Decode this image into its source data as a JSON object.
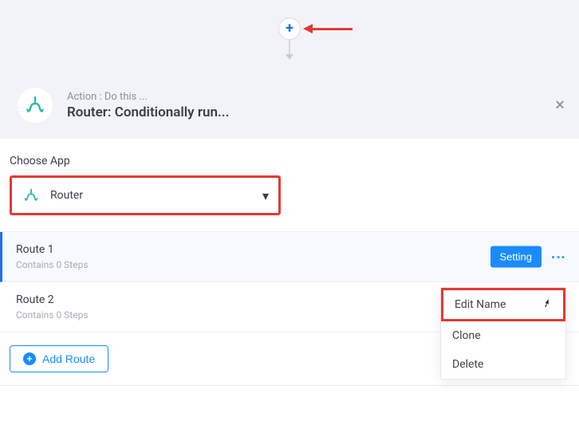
{
  "header": {
    "subtitle": "Action : Do this ...",
    "title": "Router: Conditionally run..."
  },
  "choose_app": {
    "label": "Choose App",
    "selected": "Router"
  },
  "routes": [
    {
      "name": "Route 1",
      "subtitle": "Contains 0 Steps",
      "setting_label": "Setting",
      "active": true
    },
    {
      "name": "Route 2",
      "subtitle": "Contains 0 Steps",
      "active": false
    }
  ],
  "context_menu": {
    "items": [
      {
        "label": "Edit Name",
        "highlight": true
      },
      {
        "label": "Clone",
        "highlight": false
      },
      {
        "label": "Delete",
        "highlight": false
      }
    ]
  },
  "add_route": {
    "label": "Add Route"
  },
  "colors": {
    "accent": "#1a8cff",
    "highlight_border": "#e53935",
    "muted_bg": "#f2f3f8"
  }
}
